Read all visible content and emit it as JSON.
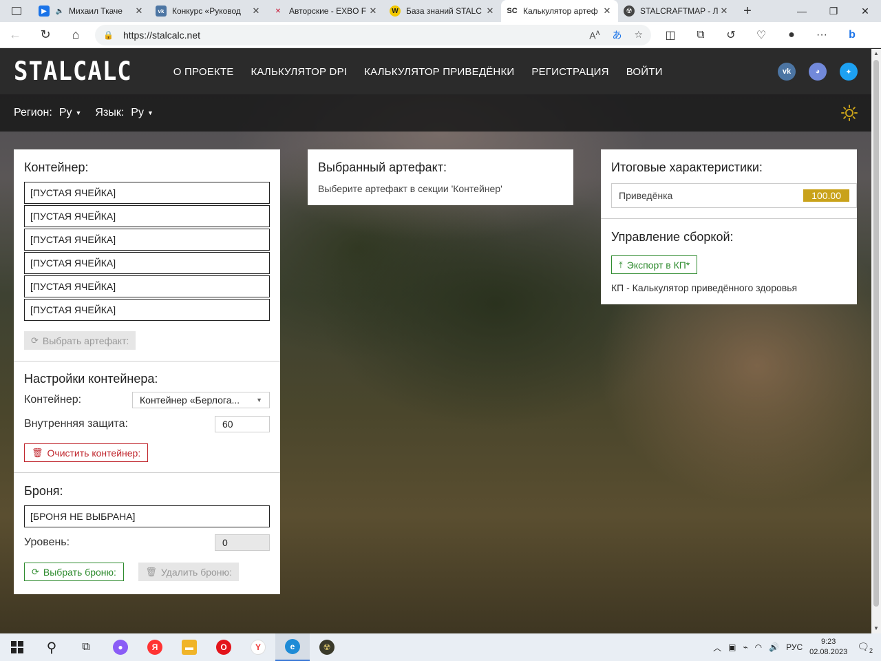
{
  "browser": {
    "tabs": [
      {
        "title": "Михаил Ткаче",
        "color": "#1a73e8",
        "glyph": "▶"
      },
      {
        "title": "Конкурс «Руковод",
        "color": "#4c75a3",
        "glyph": "vk"
      },
      {
        "title": "Авторские - EXBO F",
        "color": "#c8102e",
        "glyph": "✕"
      },
      {
        "title": "База знаний STALC",
        "color": "#f2c800",
        "glyph": "W"
      },
      {
        "title": "Калькулятор артеф",
        "color": "#222222",
        "glyph": "SC"
      },
      {
        "title": "STALCRAFTMAP - Л",
        "color": "#444444",
        "glyph": "☢"
      }
    ],
    "url": "https://stalcalc.net"
  },
  "site": {
    "logo": "STALCALC",
    "menu": [
      "О ПРОЕКТЕ",
      "КАЛЬКУЛЯТОР DPI",
      "КАЛЬКУЛЯТОР ПРИВЕДЁНКИ",
      "РЕГИСТРАЦИЯ",
      "ВОЙТИ"
    ],
    "region_label": "Регион:",
    "region_value": "Ру",
    "lang_label": "Язык:",
    "lang_value": "Ру"
  },
  "container": {
    "title": "Контейнер:",
    "slots": [
      "[ПУСТАЯ ЯЧЕЙКА]",
      "[ПУСТАЯ ЯЧЕЙКА]",
      "[ПУСТАЯ ЯЧЕЙКА]",
      "[ПУСТАЯ ЯЧЕЙКА]",
      "[ПУСТАЯ ЯЧЕЙКА]",
      "[ПУСТАЯ ЯЧЕЙКА]"
    ],
    "select_artifact": "Выбрать артефакт:",
    "settings_title": "Настройки контейнера:",
    "container_label": "Контейнер:",
    "container_value": "Контейнер «Берлога...",
    "protection_label": "Внутренняя защита:",
    "protection_value": "60",
    "clear_button": "Очистить контейнер:"
  },
  "armor": {
    "title": "Броня:",
    "slot": "[БРОНЯ НЕ ВЫБРАНА]",
    "level_label": "Уровень:",
    "level_value": "0",
    "select_button": "Выбрать броню:",
    "delete_button": "Удалить броню:"
  },
  "selected": {
    "title": "Выбранный артефакт:",
    "hint": "Выберите артефакт в секции 'Контейнер'"
  },
  "totals": {
    "title": "Итоговые характеристики:",
    "stat_label": "Приведёнка",
    "stat_value": "100.00",
    "build_title": "Управление сборкой:",
    "export_button": "Экспорт в КП*",
    "footnote": "КП - Калькулятор приведённого здоровья"
  },
  "taskbar": {
    "lang": "РУС",
    "time": "9:23",
    "date": "02.08.2023",
    "notif": "2"
  },
  "colors": {
    "accent_gold": "#c9a21a",
    "header_bg": "#2b2b2b",
    "green": "#2e8b2e",
    "red": "#c0262d"
  }
}
